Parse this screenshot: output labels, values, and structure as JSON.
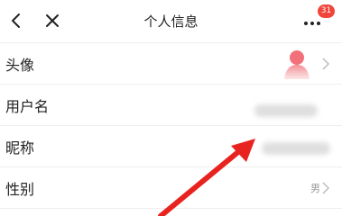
{
  "header": {
    "title": "个人信息",
    "badge_count": "31",
    "icons": {
      "back": "chevron-left-icon",
      "close": "close-icon",
      "more": "more-dots-icon"
    }
  },
  "rows": [
    {
      "label": "头像",
      "value": "",
      "icon": "avatar-icon"
    },
    {
      "label": "用户名",
      "value": ""
    },
    {
      "label": "昵称",
      "value": ""
    },
    {
      "label": "性别",
      "value": "男"
    }
  ],
  "colors": {
    "accent_red": "#f0453a",
    "annotation_arrow": "#e8231f",
    "avatar_pink": "#f2707a",
    "divider": "#eeeeee"
  }
}
